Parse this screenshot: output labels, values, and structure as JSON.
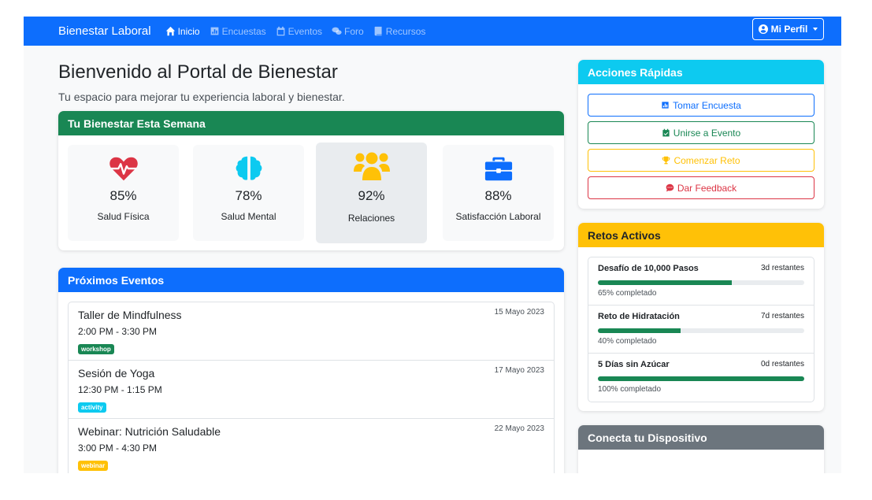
{
  "navbar": {
    "brand": "Bienestar Laboral",
    "links": [
      {
        "label": "Inicio",
        "icon": "home-icon",
        "active": true
      },
      {
        "label": "Encuestas",
        "icon": "poll-icon",
        "active": false
      },
      {
        "label": "Eventos",
        "icon": "calendar-icon",
        "active": false
      },
      {
        "label": "Foro",
        "icon": "comments-icon",
        "active": false
      },
      {
        "label": "Recursos",
        "icon": "book-icon",
        "active": false
      }
    ],
    "profile_label": "Mi Perfil"
  },
  "main": {
    "title": "Bienvenido al Portal de Bienestar",
    "subtitle": "Tu espacio para mejorar tu experiencia laboral y bienestar."
  },
  "wellbeing": {
    "header": "Tu Bienestar Esta Semana",
    "metrics": [
      {
        "value": "85%",
        "label": "Salud Física",
        "icon": "heartbeat-icon",
        "color": "#dc3545"
      },
      {
        "value": "78%",
        "label": "Salud Mental",
        "icon": "brain-icon",
        "color": "#0dcaf0"
      },
      {
        "value": "92%",
        "label": "Relaciones",
        "icon": "users-icon",
        "color": "#ffc107"
      },
      {
        "value": "88%",
        "label": "Satisfacción Laboral",
        "icon": "briefcase-icon",
        "color": "#0d6efd"
      }
    ]
  },
  "events": {
    "header": "Próximos Eventos",
    "items": [
      {
        "title": "Taller de Mindfulness",
        "time": "2:00 PM - 3:30 PM",
        "date": "15 Mayo 2023",
        "badge": "workshop",
        "badge_color": "#198754"
      },
      {
        "title": "Sesión de Yoga",
        "time": "12:30 PM - 1:15 PM",
        "date": "17 Mayo 2023",
        "badge": "activity",
        "badge_color": "#0dcaf0"
      },
      {
        "title": "Webinar: Nutrición Saludable",
        "time": "3:00 PM - 4:30 PM",
        "date": "22 Mayo 2023",
        "badge": "webinar",
        "badge_color": "#ffc107"
      }
    ]
  },
  "quick_actions": {
    "header": "Acciones Rápidas",
    "buttons": [
      {
        "label": "Tomar Encuesta",
        "icon": "poll-icon",
        "color": "#0d6efd"
      },
      {
        "label": "Unirse a Evento",
        "icon": "calendar-check-icon",
        "color": "#198754"
      },
      {
        "label": "Comenzar Reto",
        "icon": "trophy-icon",
        "color": "#ffc107"
      },
      {
        "label": "Dar Feedback",
        "icon": "comment-dots-icon",
        "color": "#dc3545"
      }
    ]
  },
  "challenges": {
    "header": "Retos Activos",
    "items": [
      {
        "title": "Desafío de 10,000 Pasos",
        "remaining": "3d restantes",
        "progress": 65,
        "progress_label": "65% completado"
      },
      {
        "title": "Reto de Hidratación",
        "remaining": "7d restantes",
        "progress": 40,
        "progress_label": "40% completado"
      },
      {
        "title": "5 Días sin Azúcar",
        "remaining": "0d restantes",
        "progress": 100,
        "progress_label": "100% completado"
      }
    ]
  },
  "device": {
    "header": "Conecta tu Dispositivo"
  }
}
